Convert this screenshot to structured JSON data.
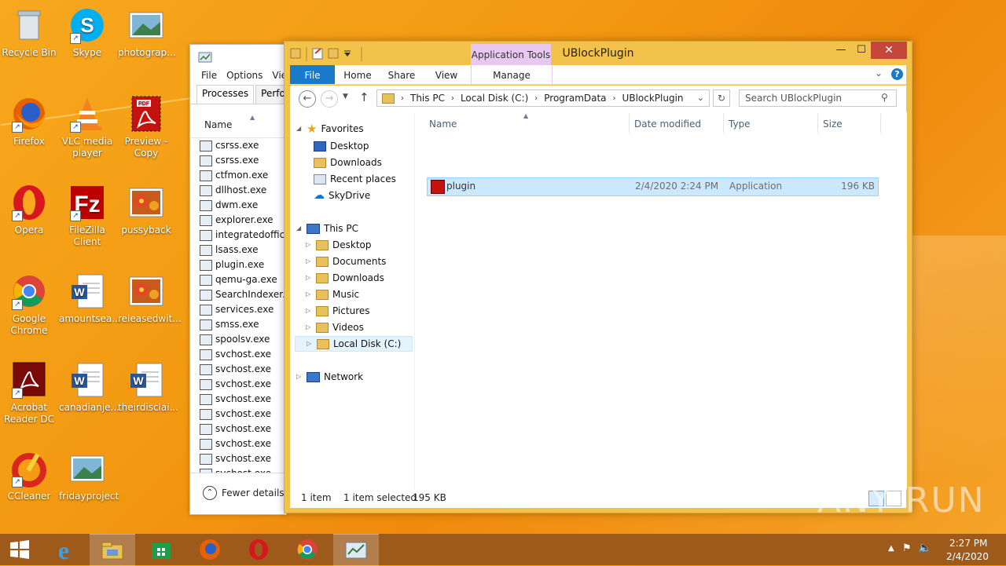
{
  "desktop": {
    "icons": [
      {
        "label": "Recycle Bin",
        "icon": "recycle-bin-icon"
      },
      {
        "label": "Skype",
        "icon": "skype-icon"
      },
      {
        "label": "photograp...",
        "icon": "image-file-icon"
      },
      {
        "label": "Firefox",
        "icon": "firefox-icon"
      },
      {
        "label": "VLC media player",
        "icon": "vlc-icon"
      },
      {
        "label": "Preview - Copy",
        "icon": "pdf-file-icon"
      },
      {
        "label": "Opera",
        "icon": "opera-icon"
      },
      {
        "label": "FileZilla Client",
        "icon": "filezilla-icon"
      },
      {
        "label": "pussyback",
        "icon": "image-file-icon"
      },
      {
        "label": "Google Chrome",
        "icon": "chrome-icon"
      },
      {
        "label": "amountsea...",
        "icon": "word-doc-icon"
      },
      {
        "label": "releasedwit...",
        "icon": "image-file-icon"
      },
      {
        "label": "Acrobat Reader DC",
        "icon": "acrobat-icon"
      },
      {
        "label": "canadianje...",
        "icon": "word-doc-icon"
      },
      {
        "label": "theirdisclai...",
        "icon": "word-doc-icon"
      },
      {
        "label": "CCleaner",
        "icon": "ccleaner-icon"
      },
      {
        "label": "fridayproject",
        "icon": "image-file-icon"
      }
    ]
  },
  "task_manager": {
    "menu": [
      "File",
      "Options",
      "View"
    ],
    "tabs": [
      "Processes",
      "Performance"
    ],
    "column": "Name",
    "processes": [
      "csrss.exe",
      "csrss.exe",
      "ctfmon.exe",
      "dllhost.exe",
      "dwm.exe",
      "explorer.exe",
      "integratedoffice.exe",
      "lsass.exe",
      "plugin.exe",
      "qemu-ga.exe",
      "SearchIndexer.exe",
      "services.exe",
      "smss.exe",
      "spoolsv.exe",
      "svchost.exe",
      "svchost.exe",
      "svchost.exe",
      "svchost.exe",
      "svchost.exe",
      "svchost.exe",
      "svchost.exe",
      "svchost.exe",
      "svchost.exe"
    ],
    "fewer_details": "Fewer details"
  },
  "explorer": {
    "title": "UBlockPlugin",
    "context_tab": "Application Tools",
    "ribbon_tabs": {
      "file": "File",
      "home": "Home",
      "share": "Share",
      "view": "View",
      "manage": "Manage"
    },
    "breadcrumb": [
      "This PC",
      "Local Disk (C:)",
      "ProgramData",
      "UBlockPlugin"
    ],
    "search_placeholder": "Search UBlockPlugin",
    "nav": {
      "favorites": "Favorites",
      "favorites_items": [
        "Desktop",
        "Downloads",
        "Recent places",
        "SkyDrive"
      ],
      "this_pc": "This PC",
      "this_pc_items": [
        "Desktop",
        "Documents",
        "Downloads",
        "Music",
        "Pictures",
        "Videos",
        "Local Disk (C:)"
      ],
      "network": "Network"
    },
    "columns": {
      "name": "Name",
      "date": "Date modified",
      "type": "Type",
      "size": "Size"
    },
    "file": {
      "name": "plugin",
      "date": "2/4/2020 2:24 PM",
      "type": "Application",
      "size": "196 KB"
    },
    "status": {
      "count": "1 item",
      "selected": "1 item selected",
      "size": "195 KB"
    }
  },
  "taskbar": {
    "time": "2:27 PM",
    "date": "2/4/2020"
  },
  "watermark": "ANY RUN"
}
